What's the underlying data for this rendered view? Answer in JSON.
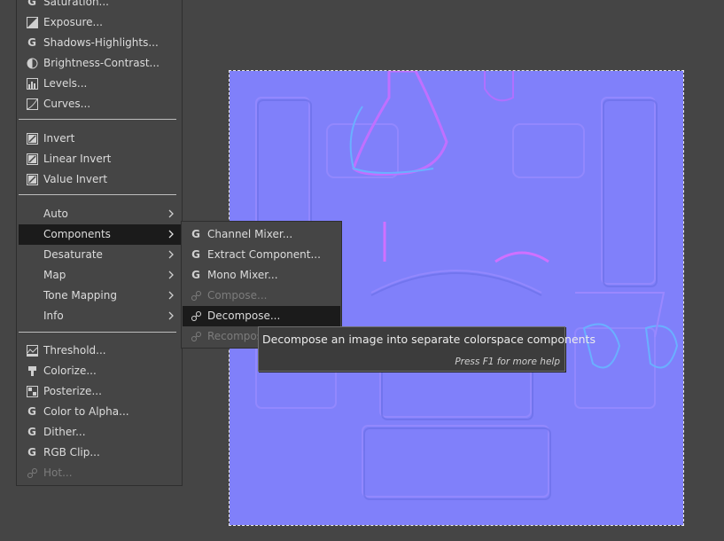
{
  "menu": {
    "items": [
      {
        "label": "Saturation...",
        "icon": "gegl-icon"
      },
      {
        "label": "Exposure...",
        "icon": "exposure-icon"
      },
      {
        "label": "Shadows-Highlights...",
        "icon": "gegl-icon"
      },
      {
        "label": "Brightness-Contrast...",
        "icon": "brightness-contrast-icon"
      },
      {
        "label": "Levels...",
        "icon": "levels-icon"
      },
      {
        "label": "Curves...",
        "icon": "curves-icon"
      },
      {
        "label": "Invert",
        "icon": "invert-icon"
      },
      {
        "label": "Linear Invert",
        "icon": "invert-icon"
      },
      {
        "label": "Value Invert",
        "icon": "invert-icon"
      },
      {
        "label": "Auto"
      },
      {
        "label": "Components"
      },
      {
        "label": "Desaturate"
      },
      {
        "label": "Map"
      },
      {
        "label": "Tone Mapping"
      },
      {
        "label": "Info"
      },
      {
        "label": "Threshold...",
        "icon": "threshold-icon"
      },
      {
        "label": "Colorize...",
        "icon": "colorize-icon"
      },
      {
        "label": "Posterize...",
        "icon": "posterize-icon"
      },
      {
        "label": "Color to Alpha...",
        "icon": "gegl-icon"
      },
      {
        "label": "Dither...",
        "icon": "gegl-icon"
      },
      {
        "label": "RGB Clip...",
        "icon": "gegl-icon"
      },
      {
        "label": "Hot...",
        "icon": "plugin-icon"
      }
    ]
  },
  "submenu": {
    "items": [
      {
        "label": "Channel Mixer...",
        "icon": "gegl-icon"
      },
      {
        "label": "Extract Component...",
        "icon": "gegl-icon"
      },
      {
        "label": "Mono Mixer...",
        "icon": "gegl-icon"
      },
      {
        "label": "Compose...",
        "icon": "plugin-icon"
      },
      {
        "label": "Decompose...",
        "icon": "plugin-icon"
      },
      {
        "label": "Recompose",
        "icon": "plugin-icon"
      }
    ]
  },
  "tooltip": {
    "text": "Decompose an image into separate colorspace components",
    "help": "Press F1 for more help"
  },
  "colors": {
    "menu_bg": "#454545",
    "highlight": "#1b1b1b",
    "canvas_base": "#8080ff"
  }
}
